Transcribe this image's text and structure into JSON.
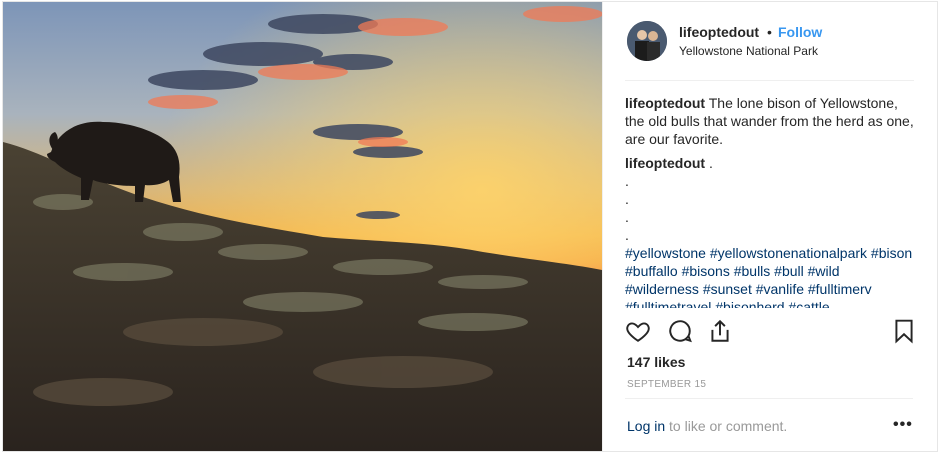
{
  "post": {
    "username": "lifeoptedout",
    "separator": "•",
    "follow_label": "Follow",
    "location": "Yellowstone National Park",
    "caption": {
      "username": "lifeoptedout",
      "text": "The lone bison of Yellowstone, the old bulls that wander from the herd as one, are our favorite."
    },
    "comment": {
      "username": "lifeoptedout",
      "first_line": ".",
      "dot_lines": [
        ".",
        ".",
        ".",
        "."
      ],
      "hashtags": "#yellowstone #yellowstonenationalpark #bison #buffallo #bisons #bulls #bull #wild #wilderness #sunset #vanlife #fulltimerv #fulltimetravel #bisonherd #cattle"
    },
    "likes": "147 likes",
    "date": "SEPTEMBER 15",
    "login_link": "Log in",
    "login_rest": " to like or comment.",
    "more_label": "•••",
    "icons": {
      "like": "heart-icon",
      "comment": "comment-icon",
      "share": "share-icon",
      "save": "bookmark-icon",
      "more": "more-options-icon"
    },
    "colors": {
      "link_blue": "#3897f0",
      "hashtag": "#003569",
      "muted": "#999999",
      "text": "#262626"
    }
  }
}
